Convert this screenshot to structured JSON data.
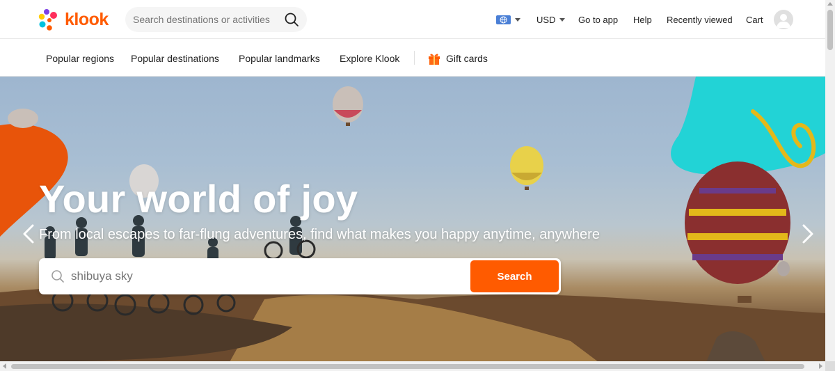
{
  "header": {
    "logo_text": "klook",
    "search_placeholder": "Search destinations or activities",
    "language_icon": "globe-icon",
    "currency": "USD",
    "links": {
      "go_to_app": "Go to app",
      "help": "Help",
      "recently_viewed": "Recently viewed",
      "cart": "Cart"
    }
  },
  "subnav": {
    "items": [
      "Popular regions",
      "Popular destinations",
      "Popular landmarks",
      "Explore Klook"
    ],
    "gift_cards": "Gift cards"
  },
  "hero": {
    "title": "Your world of joy",
    "subtitle": "From local escapes to far-flung adventures, find what makes you happy anytime, anywhere",
    "search_value": "shibuya sky",
    "search_button": "Search"
  },
  "colors": {
    "brand_orange": "#ff5b00",
    "teal_accent": "#22d3d6",
    "text_primary": "#212121"
  }
}
